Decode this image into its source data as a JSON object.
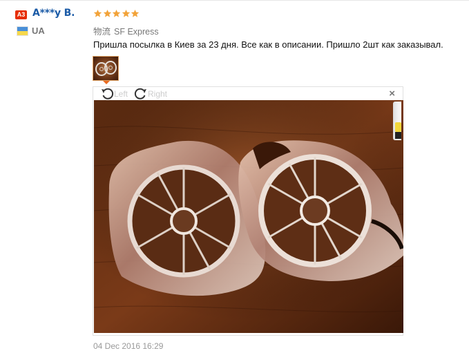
{
  "reviewer": {
    "rank_badge": "A3",
    "name": "A***y B.",
    "country_code": "UA",
    "flag_colors": [
      "#4a8fd8",
      "#f6d84b"
    ]
  },
  "review": {
    "rating": 5,
    "rating_max": 5,
    "star_color": "#f2a33a",
    "shipping_label": "物流",
    "shipping_method": "SF Express",
    "text": "Пришла посылка в Киев за 23 дня. Все как в описании. Пришло 2шт как заказывал.",
    "date": "04 Dec 2016 16:29"
  },
  "photo_viewer": {
    "rotate_left_label": "Left",
    "rotate_right_label": "Right",
    "close_symbol": "×"
  },
  "icons": {
    "rotate_left": "rotate-left-icon",
    "rotate_right": "rotate-right-icon",
    "close": "close-icon",
    "star": "star-icon",
    "flag": "flag-ua-icon"
  },
  "colors": {
    "name_link": "#1a5aa6",
    "badge_bg": "#e62e04",
    "thumb_pointer": "#e9691f"
  }
}
